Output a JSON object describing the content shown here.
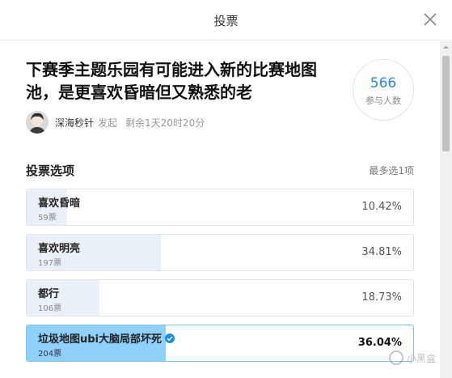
{
  "modal": {
    "title": "投票"
  },
  "poll": {
    "title": "下赛季主题乐园有可能进入新的比赛地图池，是更喜欢昏暗但又熟悉的老",
    "participants": "566",
    "participants_label": "参与人数",
    "author": "深海秒针",
    "author_action": "发起",
    "remaining": "剩余1天20时20分"
  },
  "options_section": {
    "title": "投票选项",
    "limit": "最多选1项",
    "options": [
      {
        "label": "喜欢昏暗",
        "votes": "59票",
        "percent": "10.42%",
        "fraction": 0.1042,
        "selected": false
      },
      {
        "label": "喜欢明亮",
        "votes": "197票",
        "percent": "34.81%",
        "fraction": 0.3481,
        "selected": false
      },
      {
        "label": "都行",
        "votes": "106票",
        "percent": "18.73%",
        "fraction": 0.1873,
        "selected": false
      },
      {
        "label": "垃圾地图ubi大脑局部坏死",
        "votes": "204票",
        "percent": "36.04%",
        "fraction": 0.3604,
        "selected": true
      }
    ]
  },
  "watermark": {
    "text": "小黑盒"
  },
  "colors": {
    "accent": "#2f86d6",
    "selected_fill": "#8fd1fb",
    "fill": "#eaf0f7",
    "selected_border": "#7cc4f6"
  }
}
